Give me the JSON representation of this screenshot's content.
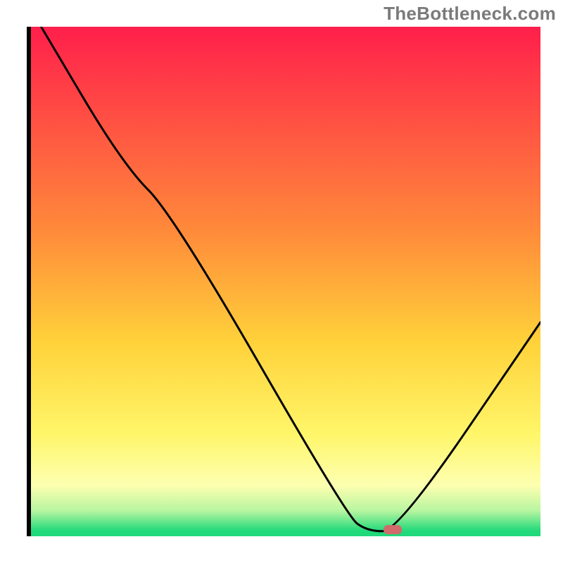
{
  "watermark": "TheBottleneck.com",
  "chart_data": {
    "type": "line",
    "title": "",
    "xlabel": "",
    "ylabel": "",
    "x_range": [
      0,
      100
    ],
    "y_range": [
      0,
      100
    ],
    "curve": {
      "name": "bottleneck-curve",
      "points": [
        {
          "x": 2,
          "y": 100
        },
        {
          "x": 18,
          "y": 73
        },
        {
          "x": 28,
          "y": 63
        },
        {
          "x": 62,
          "y": 4
        },
        {
          "x": 66,
          "y": 1
        },
        {
          "x": 72,
          "y": 1
        },
        {
          "x": 100,
          "y": 42
        }
      ]
    },
    "marker": {
      "x": 71,
      "y": 1.3,
      "color": "#d16a6a"
    },
    "gradient_stops": [
      {
        "offset": 0,
        "color": "#ff1f4b"
      },
      {
        "offset": 40,
        "color": "#ff8a3a"
      },
      {
        "offset": 62,
        "color": "#ffd23a"
      },
      {
        "offset": 80,
        "color": "#fff66a"
      },
      {
        "offset": 90,
        "color": "#fdffb0"
      },
      {
        "offset": 95,
        "color": "#b8f5a0"
      },
      {
        "offset": 99,
        "color": "#1fd97a"
      },
      {
        "offset": 100,
        "color": "#1fd97a"
      }
    ]
  }
}
